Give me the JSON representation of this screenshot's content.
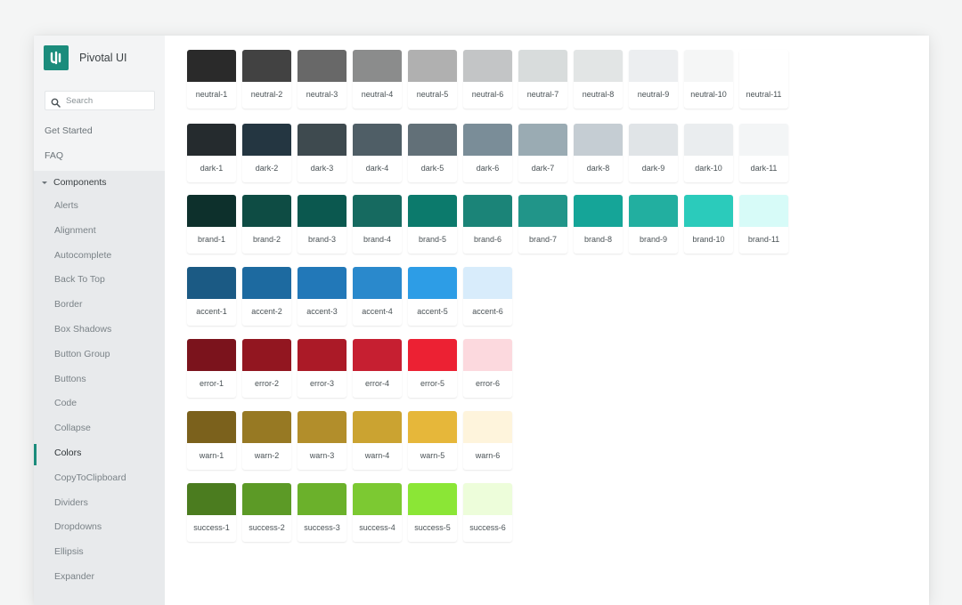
{
  "app": {
    "title": "Pivotal UI",
    "logo_icon": "pivotal-logo-icon",
    "brand_color": "#1b8c7c"
  },
  "sidebar": {
    "search": {
      "placeholder": "Search",
      "value": "",
      "icon": "search-icon"
    },
    "top_links": [
      {
        "label": "Get Started"
      },
      {
        "label": "FAQ"
      }
    ],
    "section": {
      "label": "Components",
      "expanded": true,
      "items": [
        {
          "label": "Alerts",
          "active": false
        },
        {
          "label": "Alignment",
          "active": false
        },
        {
          "label": "Autocomplete",
          "active": false
        },
        {
          "label": "Back To Top",
          "active": false
        },
        {
          "label": "Border",
          "active": false
        },
        {
          "label": "Box Shadows",
          "active": false
        },
        {
          "label": "Button Group",
          "active": false
        },
        {
          "label": "Buttons",
          "active": false
        },
        {
          "label": "Code",
          "active": false
        },
        {
          "label": "Collapse",
          "active": false
        },
        {
          "label": "Colors",
          "active": true
        },
        {
          "label": "CopyToClipboard",
          "active": false
        },
        {
          "label": "Dividers",
          "active": false
        },
        {
          "label": "Dropdowns",
          "active": false
        },
        {
          "label": "Ellipsis",
          "active": false
        },
        {
          "label": "Expander",
          "active": false
        }
      ]
    }
  },
  "palettes": [
    {
      "name": "neutral",
      "swatches": [
        {
          "label": "neutral-1",
          "color": "#2a2a2a"
        },
        {
          "label": "neutral-2",
          "color": "#424242"
        },
        {
          "label": "neutral-3",
          "color": "#686868"
        },
        {
          "label": "neutral-4",
          "color": "#8b8c8c"
        },
        {
          "label": "neutral-5",
          "color": "#b0b0b0"
        },
        {
          "label": "neutral-6",
          "color": "#c3c5c6"
        },
        {
          "label": "neutral-7",
          "color": "#d8dcdc"
        },
        {
          "label": "neutral-8",
          "color": "#e2e5e5"
        },
        {
          "label": "neutral-9",
          "color": "#eceef0"
        },
        {
          "label": "neutral-10",
          "color": "#f5f6f6"
        },
        {
          "label": "neutral-11",
          "color": "#ffffff"
        }
      ]
    },
    {
      "name": "dark",
      "swatches": [
        {
          "label": "dark-1",
          "color": "#252b2e"
        },
        {
          "label": "dark-2",
          "color": "#243641"
        },
        {
          "label": "dark-3",
          "color": "#3e4a4f"
        },
        {
          "label": "dark-4",
          "color": "#4f5e66"
        },
        {
          "label": "dark-5",
          "color": "#627078"
        },
        {
          "label": "dark-6",
          "color": "#7a8d98"
        },
        {
          "label": "dark-7",
          "color": "#9aabb3"
        },
        {
          "label": "dark-8",
          "color": "#c5cdd3"
        },
        {
          "label": "dark-9",
          "color": "#e0e4e7"
        },
        {
          "label": "dark-10",
          "color": "#eaedef"
        },
        {
          "label": "dark-11",
          "color": "#f3f5f6"
        }
      ]
    },
    {
      "name": "brand",
      "swatches": [
        {
          "label": "brand-1",
          "color": "#0d302c"
        },
        {
          "label": "brand-2",
          "color": "#0e4c44"
        },
        {
          "label": "brand-3",
          "color": "#0b584f"
        },
        {
          "label": "brand-4",
          "color": "#166a60"
        },
        {
          "label": "brand-5",
          "color": "#0c7a6c"
        },
        {
          "label": "brand-6",
          "color": "#1b8478"
        },
        {
          "label": "brand-7",
          "color": "#219589"
        },
        {
          "label": "brand-8",
          "color": "#15a598"
        },
        {
          "label": "brand-9",
          "color": "#22afa0"
        },
        {
          "label": "brand-10",
          "color": "#2bcbbb"
        },
        {
          "label": "brand-11",
          "color": "#d7fbf8"
        }
      ]
    },
    {
      "name": "accent",
      "swatches": [
        {
          "label": "accent-1",
          "color": "#1b5a84"
        },
        {
          "label": "accent-2",
          "color": "#1d6aa0"
        },
        {
          "label": "accent-3",
          "color": "#2278b8"
        },
        {
          "label": "accent-4",
          "color": "#2a89cc"
        },
        {
          "label": "accent-5",
          "color": "#2d9de6"
        },
        {
          "label": "accent-6",
          "color": "#d8ecfb"
        }
      ]
    },
    {
      "name": "error",
      "swatches": [
        {
          "label": "error-1",
          "color": "#7b131c"
        },
        {
          "label": "error-2",
          "color": "#921620"
        },
        {
          "label": "error-3",
          "color": "#ab1a27"
        },
        {
          "label": "error-4",
          "color": "#c61f31"
        },
        {
          "label": "error-5",
          "color": "#ec2133"
        },
        {
          "label": "error-6",
          "color": "#fcd9de"
        }
      ]
    },
    {
      "name": "warn",
      "swatches": [
        {
          "label": "warn-1",
          "color": "#7b611c"
        },
        {
          "label": "warn-2",
          "color": "#977923"
        },
        {
          "label": "warn-3",
          "color": "#b28e2b"
        },
        {
          "label": "warn-4",
          "color": "#cba331"
        },
        {
          "label": "warn-5",
          "color": "#e6b73a"
        },
        {
          "label": "warn-6",
          "color": "#fef4dc"
        }
      ]
    },
    {
      "name": "success",
      "swatches": [
        {
          "label": "success-1",
          "color": "#4b7c1f"
        },
        {
          "label": "success-2",
          "color": "#5c9a26"
        },
        {
          "label": "success-3",
          "color": "#6bb12b"
        },
        {
          "label": "success-4",
          "color": "#7cc932"
        },
        {
          "label": "success-5",
          "color": "#8be636"
        },
        {
          "label": "success-6",
          "color": "#edfdda"
        }
      ]
    }
  ]
}
